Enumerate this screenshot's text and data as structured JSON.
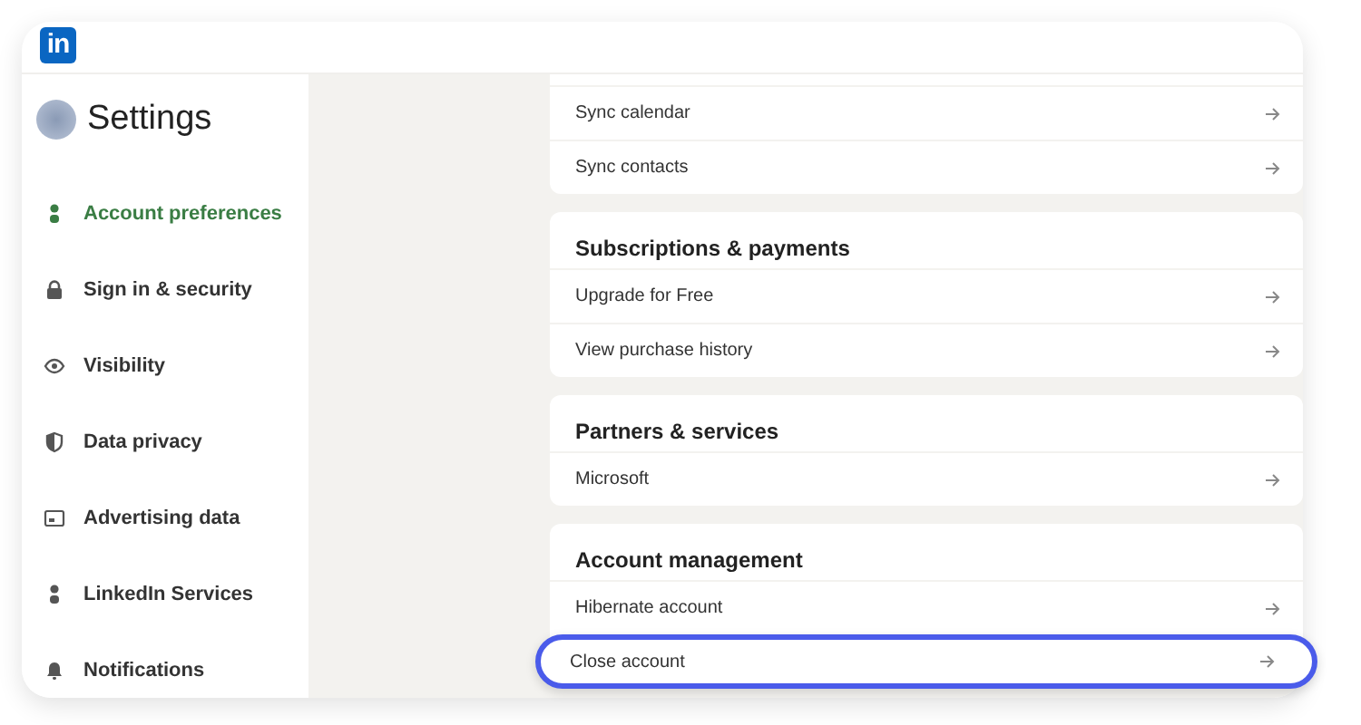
{
  "logo": "in",
  "sidebar": {
    "title": "Settings",
    "items": [
      {
        "label": "Account preferences",
        "selected": true
      },
      {
        "label": "Sign in & security",
        "selected": false
      },
      {
        "label": "Visibility",
        "selected": false
      },
      {
        "label": "Data privacy",
        "selected": false
      },
      {
        "label": "Advertising data",
        "selected": false
      },
      {
        "label": "LinkedIn Services",
        "selected": false
      },
      {
        "label": "Notifications",
        "selected": false
      }
    ]
  },
  "sections": [
    {
      "rows": [
        {
          "label": "Sync calendar",
          "highlighted": false
        },
        {
          "label": "Sync contacts",
          "highlighted": false
        }
      ]
    },
    {
      "heading": "Subscriptions & payments",
      "rows": [
        {
          "label": "Upgrade for Free",
          "highlighted": false
        },
        {
          "label": "View purchase history",
          "highlighted": false
        }
      ]
    },
    {
      "heading": "Partners & services",
      "rows": [
        {
          "label": "Microsoft",
          "highlighted": false
        }
      ]
    },
    {
      "heading": "Account management",
      "rows": [
        {
          "label": "Hibernate account",
          "highlighted": false
        },
        {
          "label": "Close account",
          "highlighted": true
        }
      ]
    }
  ]
}
